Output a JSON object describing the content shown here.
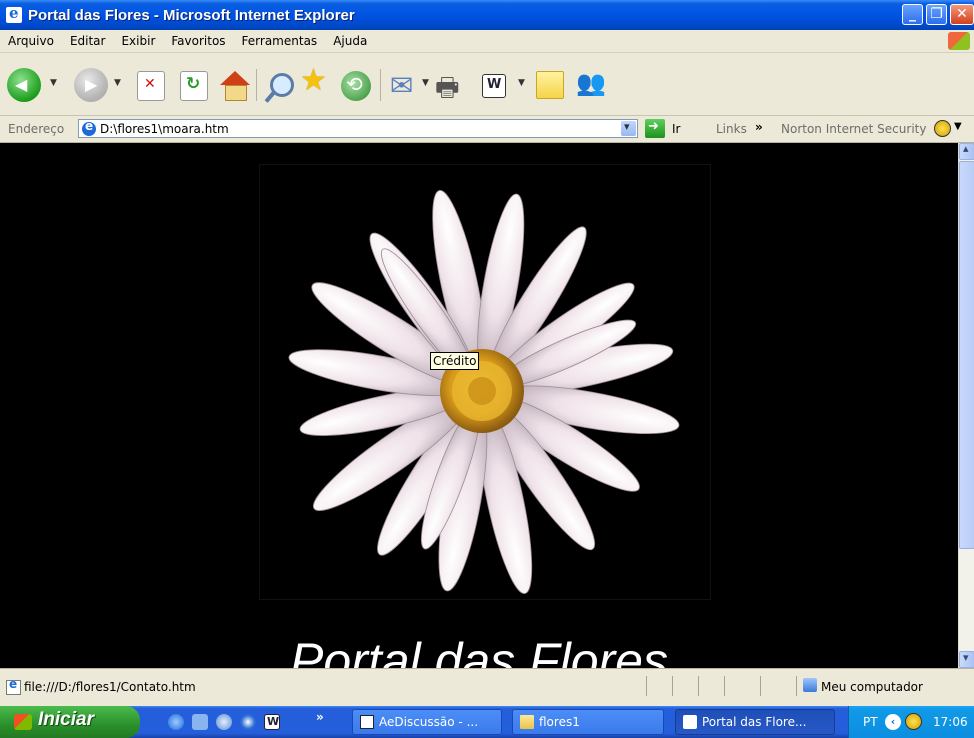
{
  "window": {
    "title": "Portal das Flores - Microsoft Internet Explorer"
  },
  "menu": [
    "Arquivo",
    "Editar",
    "Exibir",
    "Favoritos",
    "Ferramentas",
    "Ajuda"
  ],
  "address": {
    "label": "Endereço",
    "url": "D:\\flores1\\moara.htm",
    "go_label": "Ir",
    "links_label": "Links",
    "chevron": "»",
    "norton_label": "Norton Internet Security"
  },
  "page": {
    "image": {
      "alt": "daisy-photo",
      "tooltip": "Crédito"
    },
    "heading": "Portal das Flores"
  },
  "status": {
    "text": "file:///D:/flores1/Contato.htm",
    "zone": "Meu computador"
  },
  "taskbar": {
    "start_label": "Iniciar",
    "more": "»",
    "tasks": [
      {
        "label": "AeDiscussão - ...",
        "icon": "word-doc-icon"
      },
      {
        "label": "flores1",
        "icon": "folder-icon"
      },
      {
        "label": "Portal das Flore...",
        "icon": "ie-icon"
      }
    ],
    "tray": {
      "language": "PT",
      "time": "17:06"
    }
  }
}
